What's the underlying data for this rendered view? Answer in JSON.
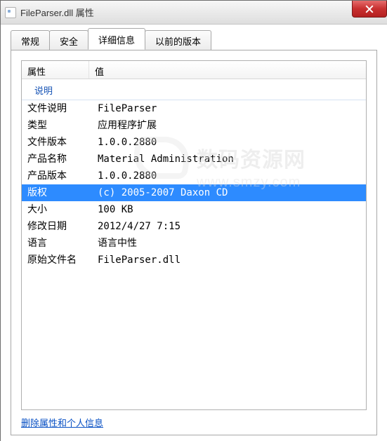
{
  "window": {
    "title": "FileParser.dll 属性"
  },
  "tabs": [
    {
      "label": "常规",
      "active": false
    },
    {
      "label": "安全",
      "active": false
    },
    {
      "label": "详细信息",
      "active": true
    },
    {
      "label": "以前的版本",
      "active": false
    }
  ],
  "listview": {
    "columns": {
      "property": "属性",
      "value": "值"
    },
    "group_label": "说明",
    "rows": [
      {
        "property": "文件说明",
        "value": "FileParser",
        "selected": false
      },
      {
        "property": "类型",
        "value": "应用程序扩展",
        "selected": false
      },
      {
        "property": "文件版本",
        "value": "1.0.0.2880",
        "selected": false
      },
      {
        "property": "产品名称",
        "value": "Material Administration",
        "selected": false
      },
      {
        "property": "产品版本",
        "value": "1.0.0.2880",
        "selected": false
      },
      {
        "property": "版权",
        "value": "(c) 2005-2007 Daxon CD",
        "selected": true
      },
      {
        "property": "大小",
        "value": "100 KB",
        "selected": false
      },
      {
        "property": "修改日期",
        "value": "2012/4/27 7:15",
        "selected": false
      },
      {
        "property": "语言",
        "value": "语言中性",
        "selected": false
      },
      {
        "property": "原始文件名",
        "value": "FileParser.dll",
        "selected": false
      }
    ]
  },
  "link": {
    "remove_personal": "删除属性和个人信息"
  },
  "watermark": {
    "brand": "数码资源网",
    "url": "www.smzy.com"
  }
}
